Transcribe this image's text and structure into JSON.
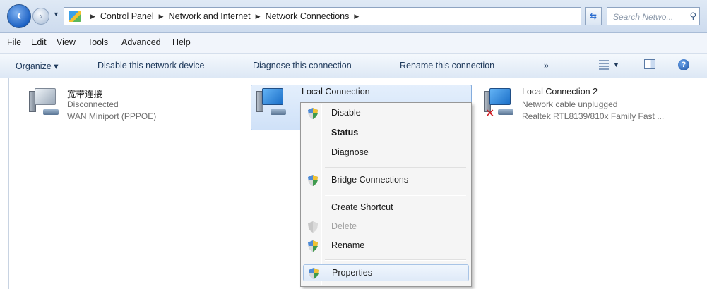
{
  "navigation": {
    "back_icon": "back-arrow-icon",
    "forward_icon": "forward-arrow-icon",
    "breadcrumbs": [
      "Control Panel",
      "Network and Internet",
      "Network Connections"
    ],
    "search_placeholder": "Search Netwo..."
  },
  "menu": [
    "File",
    "Edit",
    "View",
    "Tools",
    "Advanced",
    "Help"
  ],
  "commands": {
    "organize": "Organize ▾",
    "disable": "Disable this network device",
    "diagnose": "Diagnose this connection",
    "rename": "Rename this connection",
    "more": "»"
  },
  "connections": [
    {
      "name": "宽带连接",
      "status": "Disconnected",
      "device": "WAN Miniport (PPPOE)"
    },
    {
      "name": "Local Connection",
      "status": "",
      "device": "",
      "selected": true
    },
    {
      "name": "Local Connection 2",
      "status": "Network cable unplugged",
      "device": "Realtek RTL8139/810x Family Fast ..."
    }
  ],
  "context_menu": [
    {
      "label": "Disable",
      "icon": "shield-icon",
      "bold": false,
      "disabled": false
    },
    {
      "label": "Status",
      "icon": "",
      "bold": true,
      "disabled": false
    },
    {
      "label": "Diagnose",
      "icon": "",
      "bold": false,
      "disabled": false
    },
    {
      "label": "Bridge Connections",
      "icon": "shield-icon",
      "bold": false,
      "disabled": false
    },
    {
      "label": "Create Shortcut",
      "icon": "",
      "bold": false,
      "disabled": false
    },
    {
      "label": "Delete",
      "icon": "shield-icon",
      "bold": false,
      "disabled": true
    },
    {
      "label": "Rename",
      "icon": "shield-icon",
      "bold": false,
      "disabled": false
    },
    {
      "label": "Properties",
      "icon": "shield-icon",
      "bold": false,
      "disabled": false,
      "hovered": true
    }
  ],
  "colors": {
    "accent": "#1e395b",
    "selection": "#cfe1f8",
    "error": "#d0181e"
  }
}
